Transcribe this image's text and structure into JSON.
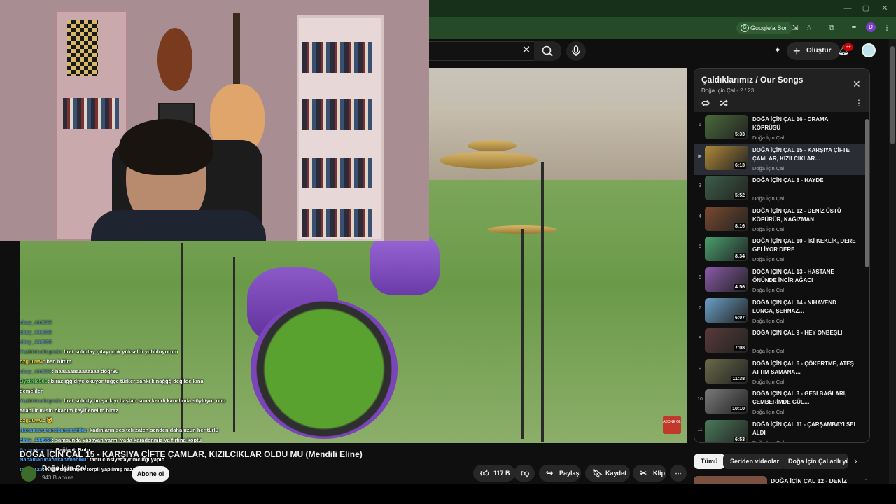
{
  "browser": {
    "google_sor": "Google'a Sor",
    "profile_initial": "D"
  },
  "masthead": {
    "create_label": "Oluştur",
    "notif_count": "9+"
  },
  "video": {
    "title": "DOĞA İÇİN ÇAL 15 - KARŞIYA ÇİFTE ÇAMLAR, KIZILCIKLAR OLDU MU (Mendili Eline)",
    "abone_badge": "ABONE OL",
    "channel": "Doğa İçin Çal",
    "subscribers": "943 B abone",
    "subscribe_label": "Abone ol",
    "actions": {
      "like_count": "117 B",
      "share": "Paylaş",
      "save": "Kaydet",
      "clip": "Klip"
    }
  },
  "chat": [
    {
      "user": "okay_444555",
      "text": "",
      "style": "faded"
    },
    {
      "user": "okay_444555",
      "text": "",
      "style": "faded"
    },
    {
      "user": "okay_444555",
      "text": "",
      "style": "faded"
    },
    {
      "user": "Yuzbirincitoprak",
      "text": ": firat sobutay çıtayı çok yükseltti yuhhluyorum",
      "style": "faded"
    },
    {
      "user": "ozguuww",
      "text": ": ben bittim",
      "style": "yellow"
    },
    {
      "user": "okay_444555",
      "text": ": haaaaaaaaaaaaaa doğr8u",
      "style": "faded"
    },
    {
      "user": "ByztKle500",
      "text": ": biraz ığğ diye okuyor tuğçe türker sanki kinağğğ değilde kına",
      "style": "green"
    },
    {
      "user": "",
      "text": "demeliler",
      "style": ""
    },
    {
      "user": "Yuzbirincitoprak",
      "text": ": firat sobuty bu şarkıyı baştan sona kendi kanalinda söylüyor onu",
      "style": "faded"
    },
    {
      "user": "",
      "text": "açabilir misin okanım keyiflenelim biraz",
      "style": ""
    },
    {
      "user": "ozguuww",
      "text": ": 🐱",
      "style": "yellow"
    },
    {
      "user": "Nanamarunanakananahiku",
      "text": ": kadınların ses teli zaten senden daha uzun her türlü",
      "style": ""
    },
    {
      "user": "okay_444555",
      "text": ": samsunda yaşayan varmı yada karadenmiz ya firtina koptu",
      "style": ""
    },
    {
      "user": "Badgekeeper",
      "text": ": Bağlantı Botu",
      "style": "faded"
    },
    {
      "user": "Nanamarunanakananahiku",
      "text": ": tanrı cinsiyet ayrımcılığı yapıo",
      "style": ""
    },
    {
      "user": "tarcin123",
      "text": ": Allah tarafından torpil yapılmış nazarın Ji",
      "style": ""
    }
  ],
  "playlist": {
    "title": "Çaldıklarımız / Our Songs",
    "channel": "Doğa İçin Çal",
    "count": "2 / 23",
    "items": [
      {
        "idx": "1",
        "title": "DOĞA İÇİN ÇAL 16 - DRAMA KÖPRÜSÜ",
        "channel": "Doğa İçin Çal",
        "duration": "5:33",
        "color": "#4a6a3a"
      },
      {
        "idx": "▶",
        "title": "DOĞA İÇİN ÇAL 15 - KARŞIYA ÇİFTE ÇAMLAR, KIZILCIKLAR…",
        "channel": "Doğa İçin Çal",
        "duration": "6:13",
        "color": "#b0893a"
      },
      {
        "idx": "3",
        "title": "DOĞA İÇİN ÇAL 8 - HAYDE",
        "channel": "Doğa İçin Çal",
        "duration": "5:52",
        "color": "#3e5e46"
      },
      {
        "idx": "4",
        "title": "DOĞA İÇİN ÇAL 12 - DENİZ ÜSTÜ KÖPÜRÜR, KAĞIZMAN",
        "channel": "Doğa İçin Çal",
        "duration": "8:16",
        "color": "#7a4a30"
      },
      {
        "idx": "5",
        "title": "DOĞA İÇİN ÇAL 10 - İKİ KEKLİK, DERE GELİYOR DERE",
        "channel": "Doğa İçin Çal",
        "duration": "8:34",
        "color": "#4aa070"
      },
      {
        "idx": "6",
        "title": "DOĞA İÇİN ÇAL 13 - HASTANE ÖNÜNDE İNCİR AĞACI",
        "channel": "Doğa İçin Çal",
        "duration": "4:56",
        "color": "#8a5aa8"
      },
      {
        "idx": "7",
        "title": "DOĞA İÇİN ÇAL 14 - NİHAVEND LONGA, ŞEHNAZ…",
        "channel": "Doğa İçin Çal",
        "duration": "6:07",
        "color": "#6aa0c8"
      },
      {
        "idx": "8",
        "title": "DOĞA İÇİN ÇAL 9 - HEY ONBEŞLİ",
        "channel": "Doğa İçin Çal",
        "duration": "7:08",
        "color": "#5a3a3a"
      },
      {
        "idx": "9",
        "title": "DOĞA İÇİN ÇAL 6 - ÇÖKERTME, ATEŞ ATTIM SAMANA…",
        "channel": "Doğa İçin Çal",
        "duration": "11:38",
        "color": "#6a6a4a"
      },
      {
        "idx": "10",
        "title": "DOĞA İÇİN ÇAL 3 - GESİ BAĞLARI, ÇEMBERİMDE GÜL…",
        "channel": "Doğa İçin Çal",
        "duration": "10:10",
        "color": "#7a7a7a"
      },
      {
        "idx": "11",
        "title": "DOĞA İÇİN ÇAL 11 - ÇARŞAMBAYI SEL ALDI",
        "channel": "Doğa İçin Çal",
        "duration": "6:53",
        "color": "#4a7a5a"
      }
    ]
  },
  "chips": [
    "Tümü",
    "Seriden videolar",
    "Doğa İçin Çal adlı yük"
  ],
  "next_video": {
    "title": "DOĞA İÇİN ÇAL 12 - DENİZ"
  }
}
